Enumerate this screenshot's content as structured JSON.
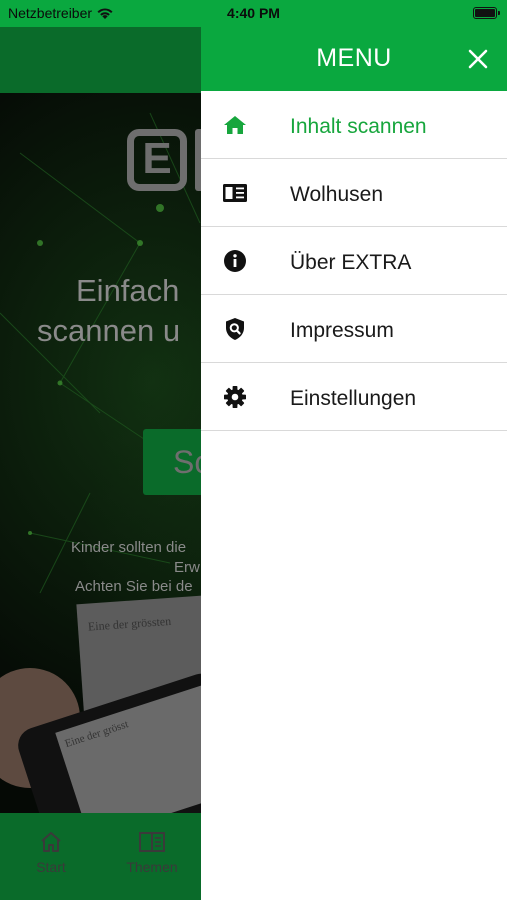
{
  "status_bar": {
    "carrier": "Netzbetreiber",
    "time": "4:40 PM"
  },
  "background_app": {
    "hero": {
      "line1": "Einfach",
      "line2": "scannen u",
      "button_label": "Sc",
      "note_line1": "Kinder sollten die",
      "note_line2": "Erw",
      "note_line3": "Achten Sie bei de",
      "paper_headline": "Eine der grössten",
      "phone_headline": "Eine der grösst"
    },
    "tabs": [
      {
        "label": "Start",
        "icon": "home-outline-icon"
      },
      {
        "label": "Themen",
        "icon": "book-outline-icon"
      }
    ]
  },
  "drawer": {
    "title": "MENU",
    "close_icon": "close-icon",
    "items": [
      {
        "label": "Inhalt scannen",
        "icon": "home-icon",
        "active": true
      },
      {
        "label": "Wolhusen",
        "icon": "newspaper-icon",
        "active": false
      },
      {
        "label": "Über EXTRA",
        "icon": "info-icon",
        "active": false
      },
      {
        "label": "Impressum",
        "icon": "shield-search-icon",
        "active": false
      },
      {
        "label": "Einstellungen",
        "icon": "gear-icon",
        "active": false
      }
    ]
  },
  "colors": {
    "accent": "#0aa83f",
    "active_text": "#17a63d",
    "dim_green": "#0a6b2a",
    "text_dark": "#1a1a1a",
    "divider": "#d9d9d9"
  }
}
